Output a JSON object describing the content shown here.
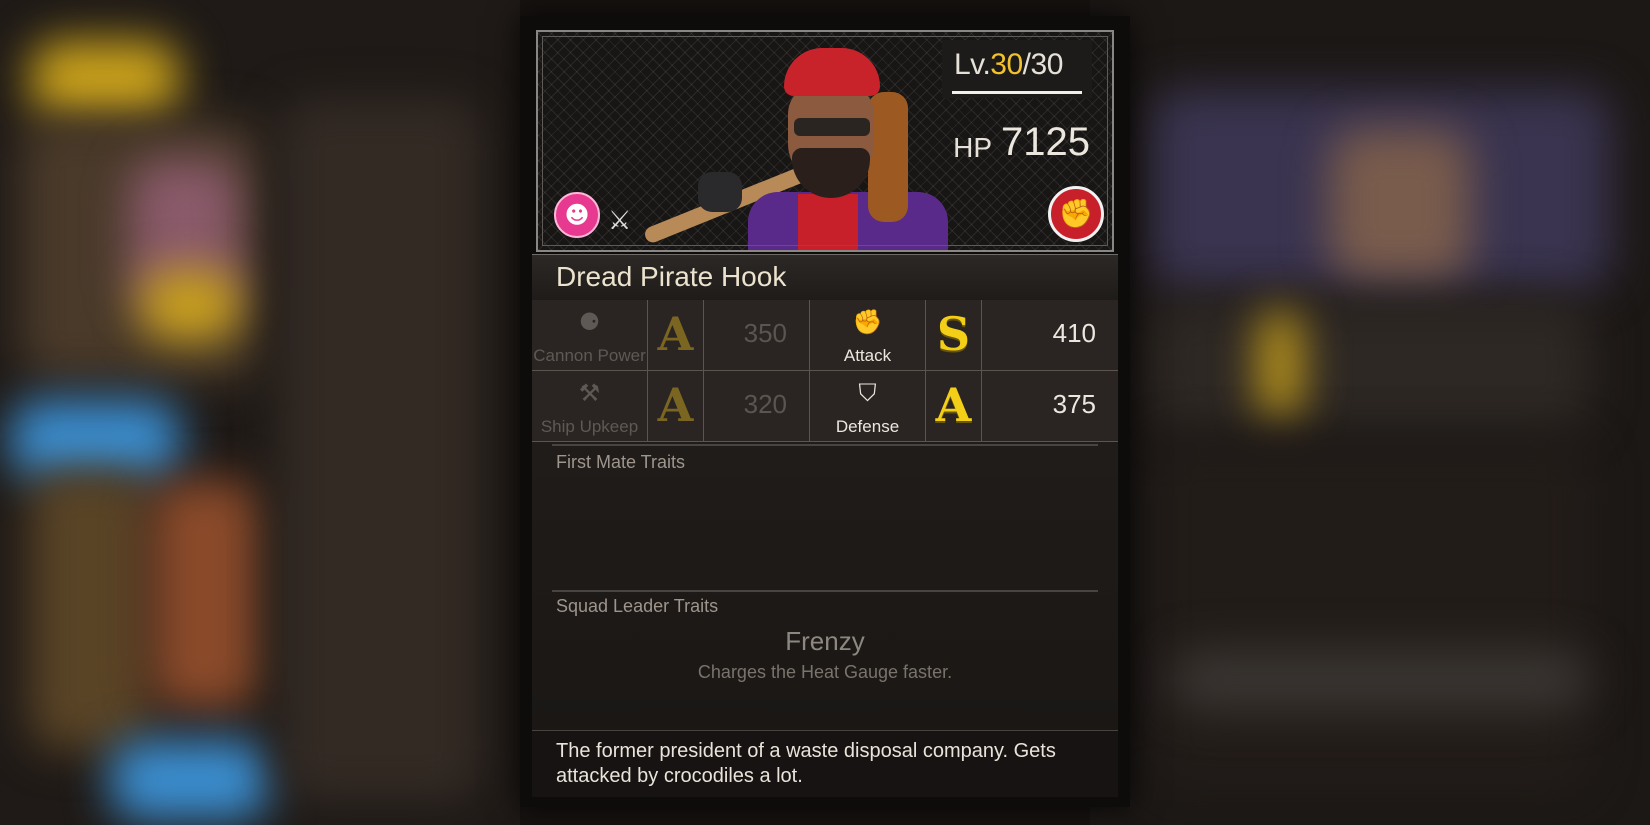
{
  "character": {
    "name": "Dread Pirate Hook",
    "level_prefix": "Lv.",
    "level_current": "30",
    "level_max": "/30",
    "hp_label": "HP",
    "hp_value": "7125",
    "mood_icon": "smiling-face-icon",
    "weapon_icon": "crossed-swords-icon",
    "type_icon": "fist-icon"
  },
  "stats": {
    "cannon_power": {
      "label": "Cannon Power",
      "grade": "A",
      "value": "350",
      "icon": "cannon-icon",
      "active": false
    },
    "attack": {
      "label": "Attack",
      "grade": "S",
      "value": "410",
      "icon": "fist-icon",
      "active": true
    },
    "ship_upkeep": {
      "label": "Ship Upkeep",
      "grade": "A",
      "value": "320",
      "icon": "wrench-hammer-icon",
      "active": false
    },
    "defense": {
      "label": "Defense",
      "grade": "A",
      "value": "375",
      "icon": "shield-icon",
      "active": true
    }
  },
  "traits": {
    "first_mate_heading": "First Mate Traits",
    "squad_leader_heading": "Squad Leader Traits",
    "squad_leader_name": "Frenzy",
    "squad_leader_desc": "Charges the Heat Gauge faster."
  },
  "description": "The former president of a waste disposal company. Gets attacked by crocodiles a lot.",
  "colors": {
    "accent_gold": "#f4cf18",
    "type_red": "#c8202a",
    "mood_pink": "#e6398f"
  }
}
